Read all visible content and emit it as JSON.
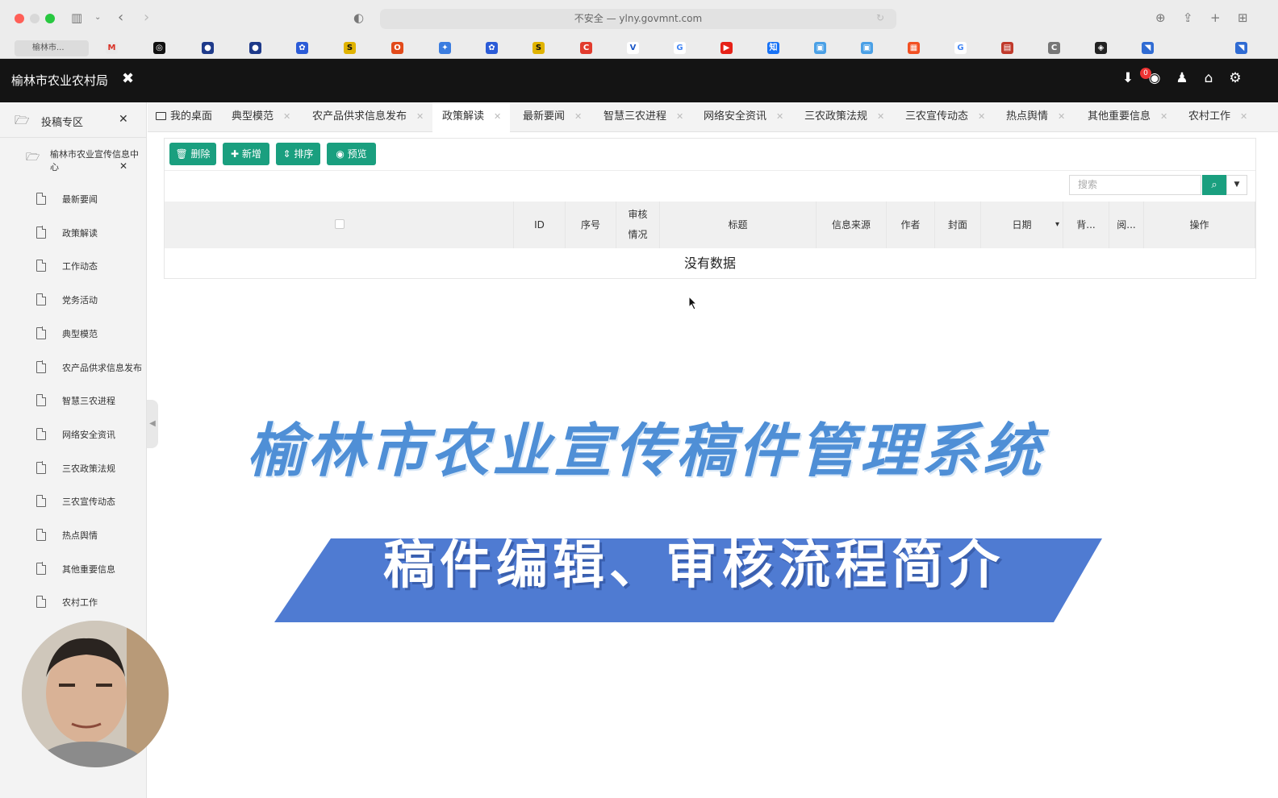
{
  "browser": {
    "url": "不安全 — ylny.govmnt.com",
    "first_tab": "榆林市...",
    "bookmarks": [
      {
        "glyph": "M",
        "color": "#e9e9e9",
        "fg": "#d93025",
        "icon": "gmail-icon"
      },
      {
        "glyph": "◎",
        "color": "#111111",
        "fg": "#ffffff",
        "icon": "black-circle-icon"
      },
      {
        "glyph": "●",
        "color": "#1e3a8a",
        "fg": "#ffffff",
        "icon": "blue-dot-icon"
      },
      {
        "glyph": "●",
        "color": "#1e3a8a",
        "fg": "#ffffff",
        "icon": "blue-dot-icon"
      },
      {
        "glyph": "✿",
        "color": "#2b5bd7",
        "fg": "#ffffff",
        "icon": "baidu-paw-icon"
      },
      {
        "glyph": "S",
        "color": "#e0b300",
        "fg": "#111111",
        "icon": "yellow-s-icon"
      },
      {
        "glyph": "O",
        "color": "#e24a1a",
        "fg": "#ffffff",
        "icon": "office-icon"
      },
      {
        "glyph": "✦",
        "color": "#3b7de0",
        "fg": "#ffffff",
        "icon": "star-icon"
      },
      {
        "glyph": "✿",
        "color": "#2b5bd7",
        "fg": "#ffffff",
        "icon": "baidu-paw-icon"
      },
      {
        "glyph": "S",
        "color": "#e0b300",
        "fg": "#111111",
        "icon": "yellow-s-icon"
      },
      {
        "glyph": "C",
        "color": "#e23b2d",
        "fg": "#ffffff",
        "icon": "red-c-icon"
      },
      {
        "glyph": "V",
        "color": "#ffffff",
        "fg": "#1a56c7",
        "icon": "v-icon"
      },
      {
        "glyph": "G",
        "color": "#ffffff",
        "fg": "#4285f4",
        "icon": "google-icon"
      },
      {
        "glyph": "▶",
        "color": "#e62117",
        "fg": "#ffffff",
        "icon": "youtube-icon"
      },
      {
        "glyph": "知",
        "color": "#1772f6",
        "fg": "#ffffff",
        "icon": "zhihu-icon"
      },
      {
        "glyph": "▣",
        "color": "#4aa0e6",
        "fg": "#ffffff",
        "icon": "bilibili-icon"
      },
      {
        "glyph": "▣",
        "color": "#4aa0e6",
        "fg": "#ffffff",
        "icon": "bilibili-icon"
      },
      {
        "glyph": "▦",
        "color": "#f25022",
        "fg": "#ffffff",
        "icon": "microsoft-icon"
      },
      {
        "glyph": "G",
        "color": "#ffffff",
        "fg": "#4285f4",
        "icon": "google-icon"
      },
      {
        "glyph": "▤",
        "color": "#c0392b",
        "fg": "#ffffff",
        "icon": "colorful-icon"
      },
      {
        "glyph": "C",
        "color": "#777777",
        "fg": "#ffffff",
        "icon": "grey-c-icon"
      },
      {
        "glyph": "◈",
        "color": "#222222",
        "fg": "#ffffff",
        "icon": "dark-app-icon"
      },
      {
        "glyph": "◥",
        "color": "#2f6bd3",
        "fg": "#ffffff",
        "icon": "blue-app-icon"
      },
      {
        "glyph": "◥",
        "color": "#2f6bd3",
        "fg": "#ffffff",
        "icon": "blue-app-icon"
      }
    ]
  },
  "header": {
    "title": "榆林市农业农村局",
    "badge_count": "0"
  },
  "sidebar": {
    "header_label": "投稿专区",
    "group_label": "榆林市农业宣传信息中心",
    "items": [
      {
        "label": "最新要闻"
      },
      {
        "label": "政策解读"
      },
      {
        "label": "工作动态"
      },
      {
        "label": "党务活动"
      },
      {
        "label": "典型模范"
      },
      {
        "label": "农产品供求信息发布"
      },
      {
        "label": "智慧三农进程"
      },
      {
        "label": "网络安全资讯"
      },
      {
        "label": "三农政策法规"
      },
      {
        "label": "三农宣传动态"
      },
      {
        "label": "热点舆情"
      },
      {
        "label": "其他重要信息"
      },
      {
        "label": "农村工作"
      }
    ]
  },
  "tabs": [
    {
      "label": "我的桌面"
    },
    {
      "label": "典型模范"
    },
    {
      "label": "农产品供求信息发布"
    },
    {
      "label": "政策解读",
      "active": true
    },
    {
      "label": "最新要闻"
    },
    {
      "label": "智慧三农进程"
    },
    {
      "label": "网络安全资讯"
    },
    {
      "label": "三农政策法规"
    },
    {
      "label": "三农宣传动态"
    },
    {
      "label": "热点舆情"
    },
    {
      "label": "其他重要信息"
    },
    {
      "label": "农村工作"
    }
  ],
  "toolbar": {
    "delete_label": "删除",
    "add_label": "新增",
    "sort_label": "排序",
    "preview_label": "预览",
    "search_placeholder": "搜索",
    "accent_color": "#1a9f7f"
  },
  "table": {
    "columns": [
      "ID",
      "序号",
      "审核情况",
      "标题",
      "信息来源",
      "作者",
      "封面",
      "日期",
      "背...",
      "阅...",
      "操作"
    ],
    "empty_text": "没有数据"
  },
  "overlay": {
    "title": "榆林市农业宣传稿件管理系统",
    "subtitle": "稿件编辑、审核流程简介",
    "title_color": "#4f8fd6",
    "banner_color": "#4f7bd2"
  }
}
